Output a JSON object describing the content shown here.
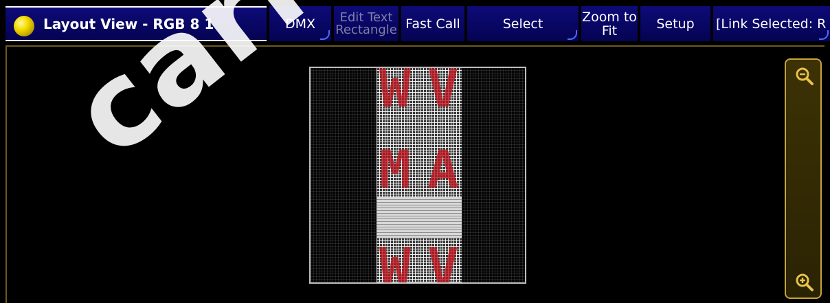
{
  "window": {
    "title": "Layout View - RGB 8 1"
  },
  "toolbar": {
    "buttons": [
      {
        "label": "DMX"
      },
      {
        "label": "Edit Text Rectangle",
        "line1": "Edit Text",
        "line2": "Rectangle",
        "state": "disabled"
      },
      {
        "label": "Fast Call"
      },
      {
        "label": "Select"
      },
      {
        "label": "Zoom to Fit",
        "line1": "Zoom to",
        "line2": "Fit"
      },
      {
        "label": "Setup"
      },
      {
        "label": "[Link Selected: R"
      }
    ]
  },
  "layout": {
    "matrix_letters": [
      "W",
      "V",
      "M",
      "A",
      "W",
      "V"
    ]
  },
  "zoom": {
    "zoom_in_icon": "zoom-in-magnifier",
    "zoom_out_icon": "zoom-out-magnifier"
  },
  "watermark": {
    "text": "carlosmeno"
  },
  "colors": {
    "toolbar_bg": "#0d0b78",
    "accent_gold": "#c8a43a",
    "led_red": "#be141e"
  }
}
